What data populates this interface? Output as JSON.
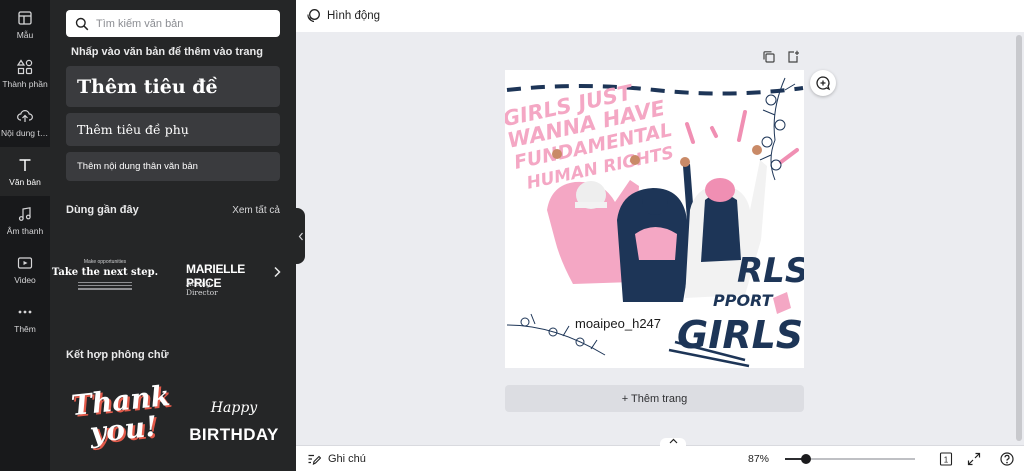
{
  "rail": {
    "items": [
      {
        "label": "Mẫu",
        "icon": "template-icon"
      },
      {
        "label": "Thành phần",
        "icon": "elements-icon"
      },
      {
        "label": "Nội dung tải lên",
        "icon": "upload-icon"
      },
      {
        "label": "Văn bản",
        "icon": "text-icon"
      },
      {
        "label": "Âm thanh",
        "icon": "music-icon"
      },
      {
        "label": "Video",
        "icon": "video-icon"
      },
      {
        "label": "Thêm",
        "icon": "more-icon"
      }
    ],
    "active_index": 3
  },
  "panel": {
    "search_placeholder": "Tìm kiếm văn bản",
    "hint": "Nhấp vào văn bản để thêm vào trang",
    "add_heading": "Thêm tiêu đề",
    "add_subheading": "Thêm tiêu đề phụ",
    "add_body": "Thêm nội dung thân văn bản",
    "recent_title": "Dùng gần đây",
    "see_all": "Xem tất cả",
    "recent_tiles": {
      "t1_small": "Make opportunities",
      "t1_big": "Take the next step.",
      "t2_name": "MARIELLE PRICE",
      "t2_role": "Acting Director"
    },
    "font_combos_title": "Kết hợp phông chữ",
    "combo_thank": "Thank you!",
    "combo_happy": "Happy",
    "combo_birthday": "BIRTHDAY"
  },
  "topbar": {
    "animation_label": "Hình động"
  },
  "canvas": {
    "design_text_handle": "moaipeo_h247",
    "poster_texts": [
      "GIRLS JUST",
      "WANNA HAVE",
      "FUNDAMENTAL",
      "HUMAN RIGHTS",
      "RLS",
      "PPORT",
      "GIRLS"
    ],
    "add_page_label": "+ Thêm trang"
  },
  "bottombar": {
    "notes_label": "Ghi chú",
    "zoom": "87%",
    "zoom_fraction": 0.87,
    "page_count": "1"
  },
  "colors": {
    "rail_bg": "#18191b",
    "panel_bg": "#252627",
    "pink": "#f4a7c4",
    "navy": "#1d3557"
  }
}
